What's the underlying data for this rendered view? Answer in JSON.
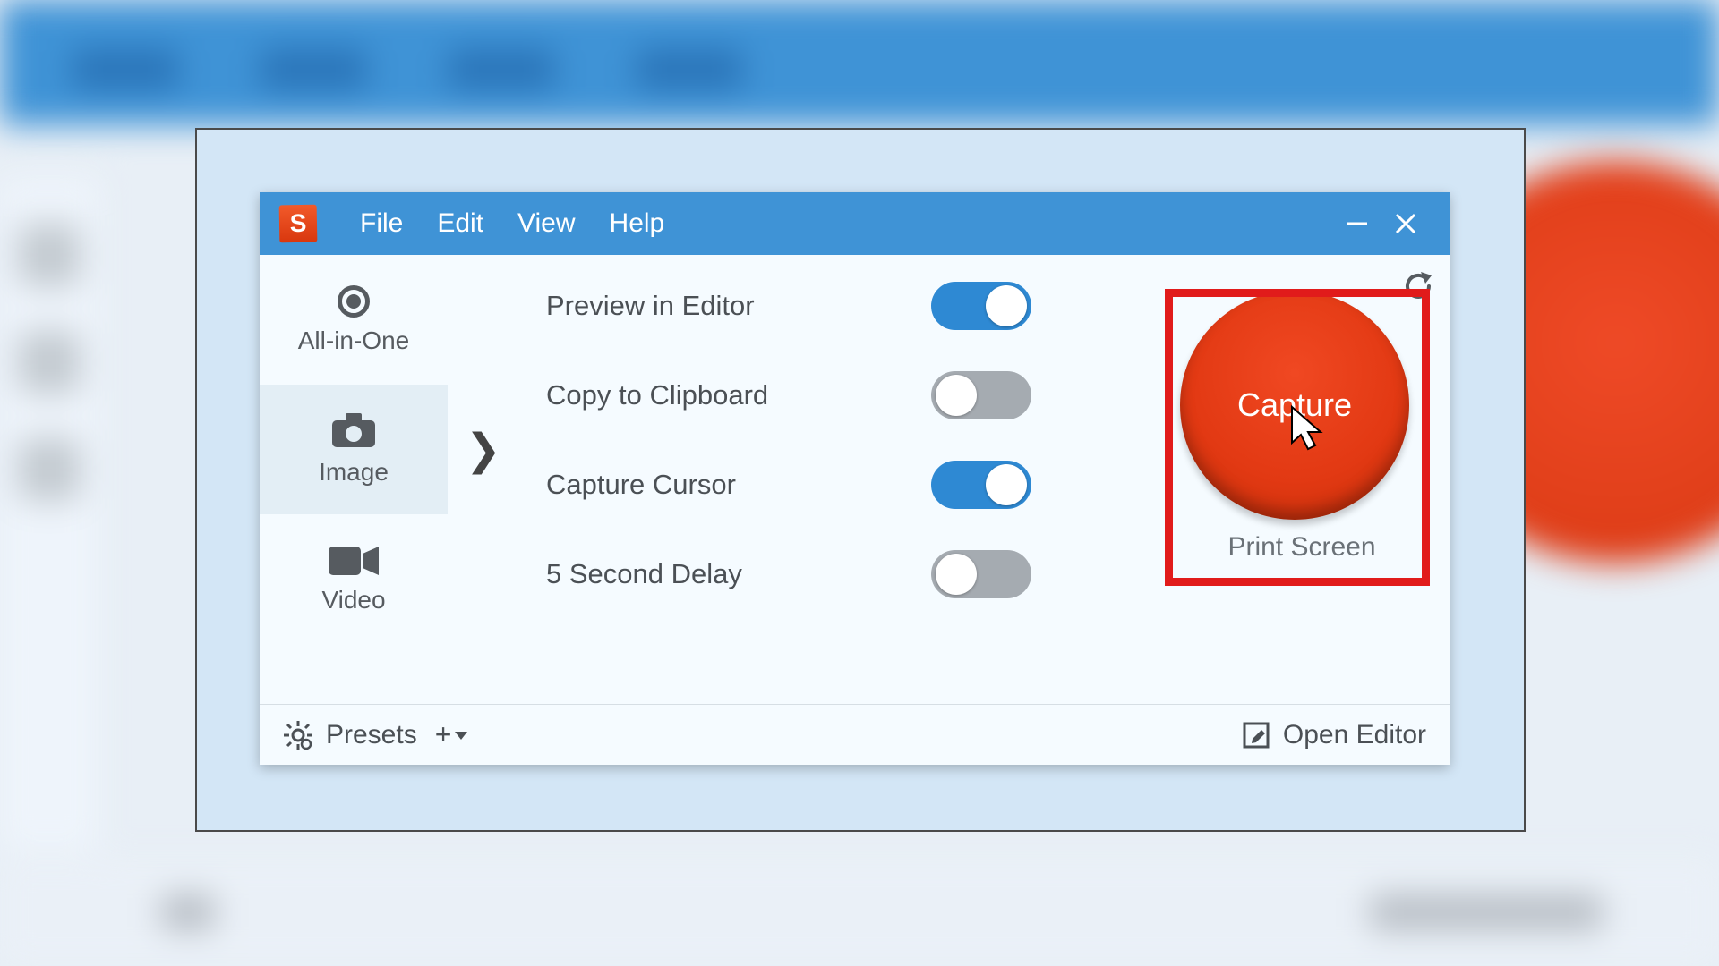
{
  "app": {
    "logo_letter": "S"
  },
  "menubar": {
    "file": "File",
    "edit": "Edit",
    "view": "View",
    "help": "Help"
  },
  "sidebar": {
    "all_in_one": "All-in-One",
    "image": "Image",
    "video": "Video",
    "selected": "image"
  },
  "options": [
    {
      "label": "Preview in Editor",
      "on": true
    },
    {
      "label": "Copy to Clipboard",
      "on": false
    },
    {
      "label": "Capture Cursor",
      "on": true
    },
    {
      "label": "5 Second Delay",
      "on": false
    }
  ],
  "capture": {
    "button_label": "Capture",
    "hotkey_label": "Print Screen"
  },
  "footer": {
    "presets": "Presets",
    "open_editor": "Open Editor"
  },
  "colors": {
    "accent": "#3f93d6",
    "capture": "#e23913",
    "highlight": "#e11b1b"
  }
}
